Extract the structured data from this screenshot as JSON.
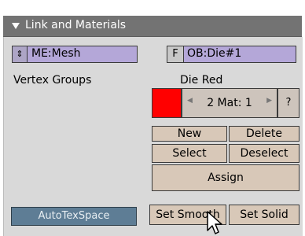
{
  "panel": {
    "title": "Link and Materials"
  },
  "mesh_block": {
    "name": "ME:Mesh",
    "arrow_icon": "updown-arrows-icon"
  },
  "object_block": {
    "flag": "F",
    "name": "OB:Die#1"
  },
  "vertex_groups": {
    "label": "Vertex Groups"
  },
  "material": {
    "name": "Die Red",
    "color": "#ff0000",
    "index_label": "2 Mat: 1",
    "help_label": "?"
  },
  "buttons": {
    "new": "New",
    "delete": "Delete",
    "select": "Select",
    "deselect": "Deselect",
    "assign": "Assign",
    "autotex": "AutoTexSpace",
    "set_smooth": "Set Smooth",
    "set_solid": "Set Solid"
  }
}
